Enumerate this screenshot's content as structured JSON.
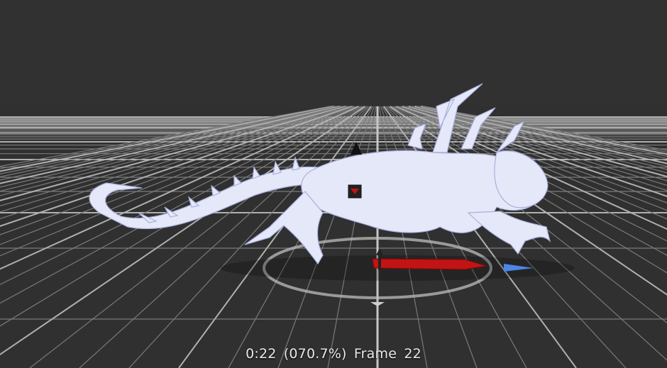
{
  "playback": {
    "time": "0:22",
    "progress": "(070.7%)",
    "frame_label": "Frame",
    "frame_number": "22"
  },
  "colors": {
    "background": "#313131",
    "grid_major": "#a9a9a9",
    "grid_minor": "#6e6e6e",
    "model": "#e7eaf9",
    "model_shade": "#9aa3d8",
    "gizmo_red": "#c21414",
    "gizmo_blue": "#4a86e6"
  }
}
